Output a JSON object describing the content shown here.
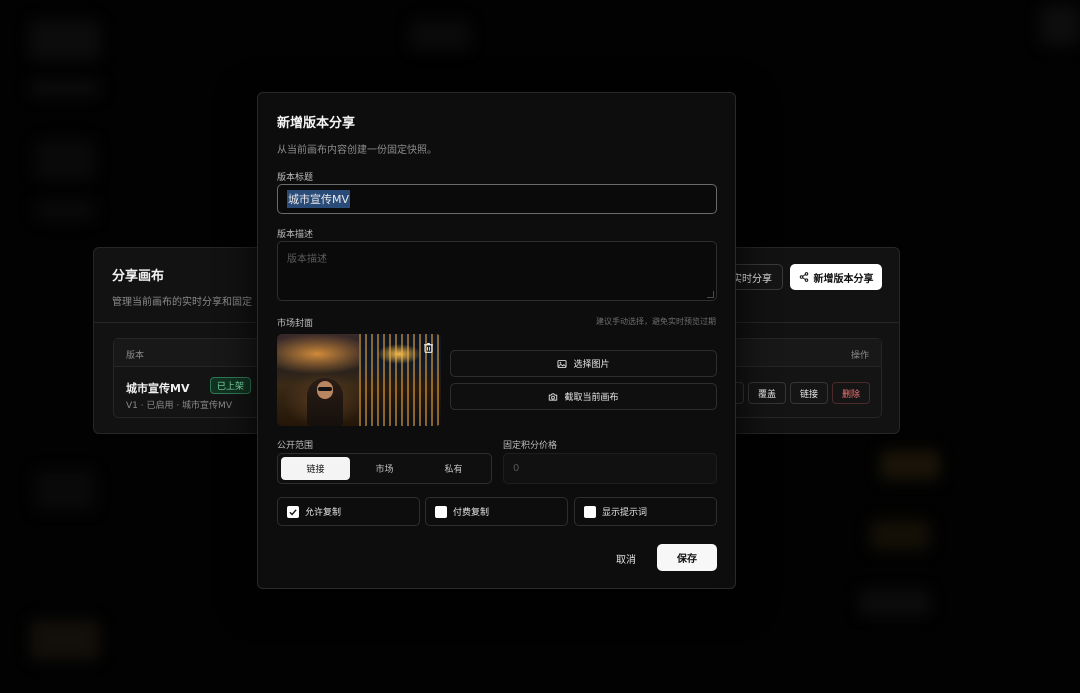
{
  "share_panel": {
    "title": "分享画布",
    "subtitle": "管理当前画布的实时分享和固定",
    "live_share_label": "实时分享",
    "new_version_label": "新增版本分享",
    "table": {
      "col_version": "版本",
      "col_actions": "操作",
      "row": {
        "title": "城市宣传MV",
        "badge": "已上架",
        "meta": "V1 · 已启用 · 城市宣传MV",
        "actions": [
          "覆盖",
          "链接",
          "删除"
        ]
      }
    }
  },
  "dialog": {
    "title": "新增版本分享",
    "subtitle": "从当前画布内容创建一份固定快照。",
    "version_title_label": "版本标题",
    "version_title_value": "城市宣传MV",
    "version_desc_label": "版本描述",
    "version_desc_placeholder": "版本描述",
    "cover_label": "市场封面",
    "cover_hint": "建议手动选择，避免实时预览过期",
    "select_image_label": "选择图片",
    "capture_canvas_label": "截取当前画布",
    "visibility_label": "公开范围",
    "visibility_options": [
      "链接",
      "市场",
      "私有"
    ],
    "visibility_selected": "链接",
    "price_label": "固定积分价格",
    "price_value": "0",
    "checkboxes": [
      {
        "label": "允许复制",
        "checked": true
      },
      {
        "label": "付费复制",
        "checked": false
      },
      {
        "label": "显示提示词",
        "checked": false
      }
    ],
    "cancel_label": "取消",
    "save_label": "保存"
  },
  "icons": {
    "share": "share-icon",
    "image": "image-icon",
    "camera": "camera-icon",
    "trash": "trash-icon",
    "check": "check-icon"
  },
  "colors": {
    "badge_green": "#7ee0a8",
    "danger": "#f07575",
    "selection": "#2a4a78"
  }
}
